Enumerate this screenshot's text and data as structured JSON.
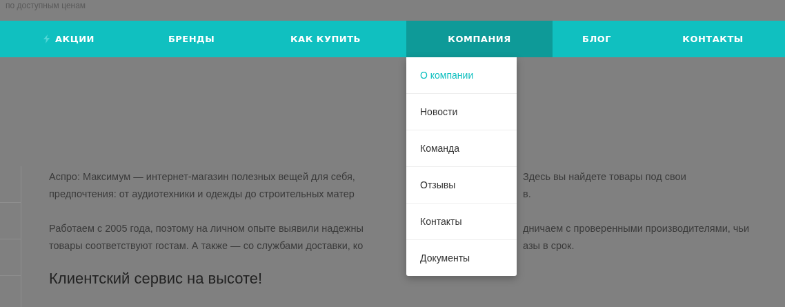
{
  "top_text": "по доступным ценам",
  "nav": [
    {
      "label": "АКЦИИ",
      "kind": "promo",
      "selected": false
    },
    {
      "label": "БРЕНДЫ",
      "kind": "plain",
      "selected": false
    },
    {
      "label": "КАК КУПИТЬ",
      "kind": "plain",
      "selected": false
    },
    {
      "label": "КОМПАНИЯ",
      "kind": "plain",
      "selected": true
    },
    {
      "label": "БЛОГ",
      "kind": "plain",
      "selected": false
    },
    {
      "label": "КОНТАКТЫ",
      "kind": "plain",
      "selected": false
    }
  ],
  "dropdown": [
    {
      "label": "О компании",
      "selected": true
    },
    {
      "label": "Новости",
      "selected": false
    },
    {
      "label": "Команда",
      "selected": false
    },
    {
      "label": "Отзывы",
      "selected": false
    },
    {
      "label": "Контакты",
      "selected": false
    },
    {
      "label": "Документы",
      "selected": false
    }
  ],
  "paragraphs": [
    [
      {
        "left": "Аспро: Максимум — интернет-магазин полезных вещей для себя,",
        "right": "Здесь вы найдете товары под свои"
      },
      {
        "left": "предпочтения: от аудиотехники и одежды до строительных матер",
        "right": "в."
      }
    ],
    [
      {
        "left": "Работаем с 2005 года, поэтому на личном опыте выявили надежны",
        "right": "дничаем с проверенными производителями, чьи"
      },
      {
        "left": "товары соответствуют гостам. А также — со службами доставки, ко",
        "right": "азы в срок."
      }
    ]
  ],
  "heading": "Клиентский сервис на высоте!"
}
